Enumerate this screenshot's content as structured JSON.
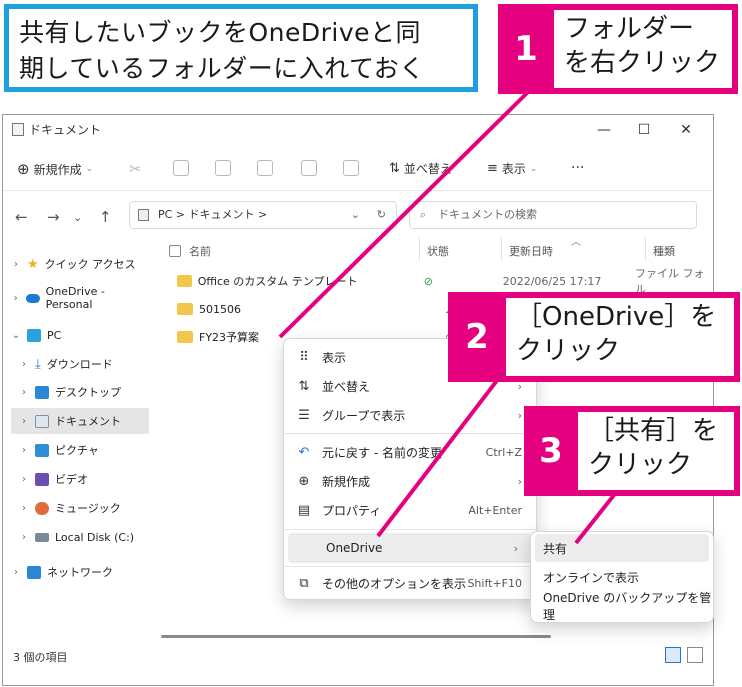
{
  "instruction": {
    "line1": "共有したいブックをOneDriveと同",
    "line2": "期しているフォルダーに入れておく"
  },
  "steps": [
    {
      "num": "1",
      "line1": "フォルダー",
      "line2": "を右クリック"
    },
    {
      "num": "2",
      "line1": "［OneDrive］を",
      "line2": "クリック"
    },
    {
      "num": "3",
      "line1": "［共有］を",
      "line2": "クリック"
    }
  ],
  "window": {
    "title": "ドキュメント",
    "toolbar": {
      "new": "新規作成",
      "sort": "並べ替え",
      "view": "表示",
      "more": "···"
    },
    "address": "PC  >  ドキュメント  >",
    "search_placeholder": "ドキュメントの検索",
    "sidebar": [
      {
        "label": "クイック アクセス",
        "icon": "star-icon"
      },
      {
        "label": "OneDrive - Personal",
        "icon": "cloud-icon"
      },
      {
        "label": "PC",
        "icon": "pc-icon"
      },
      {
        "label": "ダウンロード",
        "icon": "download-icon"
      },
      {
        "label": "デスクトップ",
        "icon": "desktop-icon"
      },
      {
        "label": "ドキュメント",
        "icon": "document-icon"
      },
      {
        "label": "ピクチャ",
        "icon": "picture-icon"
      },
      {
        "label": "ビデオ",
        "icon": "video-icon"
      },
      {
        "label": "ミュージック",
        "icon": "music-icon"
      },
      {
        "label": "Local Disk (C:)",
        "icon": "disk-icon"
      },
      {
        "label": "ネットワーク",
        "icon": "network-icon"
      }
    ],
    "columns": {
      "name": "名前",
      "status": "状態",
      "date": "更新日時",
      "type": "種類"
    },
    "files": [
      {
        "name": "Office のカスタム テンプレート",
        "date": "2022/06/25 17:17",
        "type": "ファイル フォル"
      },
      {
        "name": "501506",
        "date": "",
        "type": ""
      },
      {
        "name": "FY23予算案",
        "date": "",
        "type": ""
      }
    ],
    "status": "3 個の項目"
  },
  "context_menu": {
    "items": [
      {
        "label": "表示",
        "icon": "grid-icon",
        "shortcut": "",
        "arrow": ""
      },
      {
        "label": "並べ替え",
        "icon": "sort-icon",
        "shortcut": "",
        "arrow": "›"
      },
      {
        "label": "グループで表示",
        "icon": "group-icon",
        "shortcut": "",
        "arrow": "›"
      },
      {
        "label": "元に戻す - 名前の変更",
        "icon": "undo-icon",
        "shortcut": "Ctrl+Z",
        "arrow": ""
      },
      {
        "label": "新規作成",
        "icon": "plus-icon",
        "shortcut": "",
        "arrow": "›"
      },
      {
        "label": "プロパティ",
        "icon": "properties-icon",
        "shortcut": "Alt+Enter",
        "arrow": ""
      },
      {
        "label": "OneDrive",
        "icon": "",
        "shortcut": "",
        "arrow": "›"
      },
      {
        "label": "その他のオプションを表示",
        "icon": "more-options-icon",
        "shortcut": "Shift+F10",
        "arrow": ""
      }
    ]
  },
  "submenu": {
    "items": [
      "共有",
      "オンラインで表示",
      "OneDrive のバックアップを管理"
    ]
  },
  "colors": {
    "accent_pink": "#e4007f",
    "callout_blue": "#1f9fe0"
  }
}
